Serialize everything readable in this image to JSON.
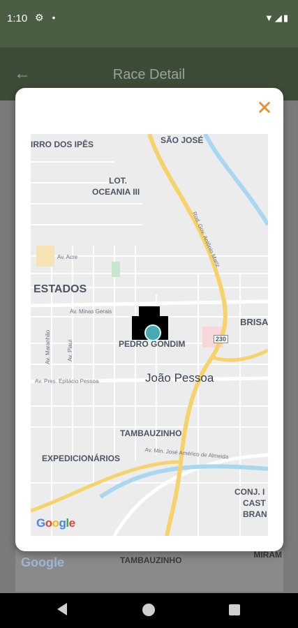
{
  "status_bar": {
    "time": "1:10",
    "left_icons": [
      "gear-icon",
      "dot-icon"
    ],
    "right_icons": [
      "wifi-icon",
      "signal-icon",
      "battery-icon"
    ]
  },
  "app_bar": {
    "title": "Race Detail",
    "back_icon": "arrow-back-icon"
  },
  "background_map": {
    "google": "Google",
    "label_tamb": "TAMBAUZINHO",
    "label_miram": "MIRAM"
  },
  "modal": {
    "close_icon": "close-icon",
    "map": {
      "labels": {
        "irro": "IRRO DOS IPÊS",
        "sao_jose": "SÃO JOSÉ",
        "lot": "LOT.",
        "oceania": "OCEANIA III",
        "estados": "ESTADOS",
        "brisa": "BRISA",
        "pedro": "PEDRO GONDIM",
        "joao": "João Pessoa",
        "tamb": "TAMBAUZINHO",
        "exped": "EXPEDICIONÁRIOS",
        "conj": "CONJ. I",
        "cast": "CAST",
        "bran": "BRAN",
        "route": "230"
      },
      "streets": {
        "av_acre": "Av. Acre",
        "av_minas": "Av. Minas Gerais",
        "av_maranhao": "Av. Maranhão",
        "av_piaui": "Av. Piauí",
        "av_epitacio": "Av. Pres. Epitácio Pessoa",
        "rod_gov": "Rod. Gov. Antônio Mariz",
        "av_min_jose": "Av. Min. José Américo de Almeida"
      },
      "google": [
        "G",
        "o",
        "o",
        "g",
        "l",
        "e"
      ]
    }
  },
  "nav_bar": {
    "back": "nav-back-icon",
    "home": "nav-home-icon",
    "recents": "nav-recents-icon"
  },
  "colors": {
    "status_bar": "#4a5e44",
    "accent_close": "#f08a2a",
    "highway": "#f6d36a",
    "water": "#a9d7f0"
  }
}
